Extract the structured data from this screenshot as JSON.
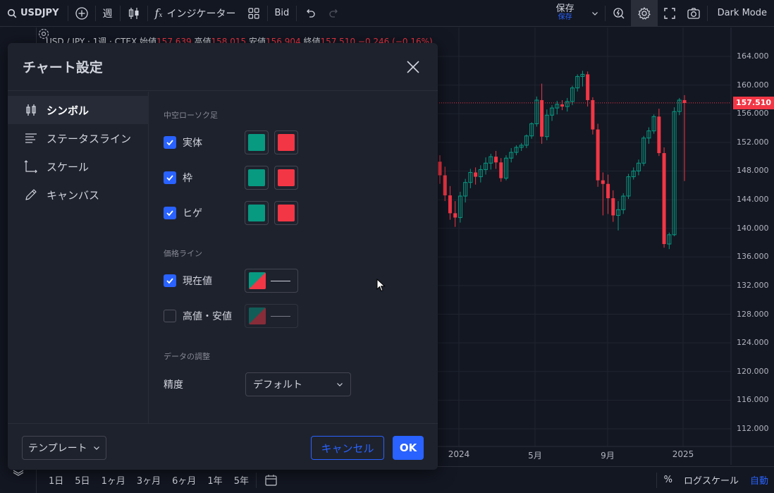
{
  "topbar": {
    "symbol": "USDJPY",
    "interval": "週",
    "indicators_label": "インジケーター",
    "price_source": "Bid",
    "save_label": "保存",
    "save_sub": "保存",
    "theme_label": "Dark Mode"
  },
  "legend": {
    "title": "USD / JPY · 1週 · CTEX",
    "open_label": "始値",
    "open": "157.639",
    "high_label": "高値",
    "high": "158.015",
    "low_label": "安値",
    "low": "156.904",
    "close_label": "終値",
    "close": "157.510",
    "change": "−0.246 (−0.16%)"
  },
  "price_badge": "157.510",
  "y_axis": [
    "164.000",
    "160.000",
    "156.000",
    "152.000",
    "148.000",
    "144.000",
    "140.000",
    "136.000",
    "132.000",
    "128.000",
    "124.000",
    "120.000",
    "116.000",
    "112.000"
  ],
  "x_axis": [
    "2024",
    "5月",
    "9月",
    "2025"
  ],
  "bottombar": {
    "ranges": [
      "1日",
      "5日",
      "1ヶ月",
      "3ヶ月",
      "6ヶ月",
      "1年",
      "5年"
    ],
    "percent": "%",
    "log_scale": "ログスケール",
    "auto": "自動"
  },
  "dialog": {
    "title": "チャート設定",
    "nav": [
      "シンボル",
      "ステータスライン",
      "スケール",
      "キャンバス"
    ],
    "sections": {
      "hollow_candles": "中空ローソク足",
      "price_lines": "価格ライン",
      "data_adjust": "データの調整"
    },
    "rows": {
      "body": "実体",
      "border": "枠",
      "wick": "ヒゲ",
      "last_price": "現在値",
      "high_low": "高値・安値",
      "precision": "精度"
    },
    "precision_value": "デフォルト",
    "template_label": "テンプレート",
    "cancel_label": "キャンセル",
    "ok_label": "OK"
  },
  "colors": {
    "up": "#089981",
    "down": "#f23645",
    "accent": "#2962ff"
  },
  "chart_data": {
    "type": "candlestick",
    "y_range": [
      110,
      166
    ],
    "x_range": [
      "2023-10",
      "2025-01"
    ],
    "last_price": 157.51,
    "candles": [
      [
        149.3,
        150.2,
        146.2,
        147.4
      ],
      [
        147.4,
        148.6,
        143.8,
        144.6
      ],
      [
        144.6,
        145.9,
        141.2,
        142.1
      ],
      [
        142.1,
        143.8,
        140.2,
        141.5
      ],
      [
        141.5,
        145.1,
        140.8,
        144.5
      ],
      [
        144.5,
        146.9,
        143.6,
        146.4
      ],
      [
        146.4,
        148.3,
        145.6,
        147.8
      ],
      [
        147.8,
        148.5,
        146.1,
        147.2
      ],
      [
        147.2,
        148.8,
        146.4,
        148.2
      ],
      [
        148.2,
        149.9,
        147.5,
        149.1
      ],
      [
        149.1,
        150.4,
        148.2,
        150.0
      ],
      [
        150.0,
        150.8,
        148.3,
        149.2
      ],
      [
        149.2,
        149.8,
        146.5,
        147.0
      ],
      [
        147.0,
        150.2,
        146.7,
        149.8
      ],
      [
        149.8,
        151.2,
        149.2,
        150.6
      ],
      [
        150.6,
        151.6,
        150.2,
        151.3
      ],
      [
        151.3,
        151.9,
        150.8,
        151.6
      ],
      [
        151.6,
        153.1,
        151.2,
        152.9
      ],
      [
        152.9,
        154.8,
        152.5,
        154.6
      ],
      [
        154.6,
        158.4,
        154.2,
        157.9
      ],
      [
        157.9,
        160.2,
        151.8,
        152.8
      ],
      [
        152.8,
        156.6,
        152.3,
        155.8
      ],
      [
        155.8,
        157.2,
        155.0,
        156.8
      ],
      [
        156.8,
        157.8,
        155.9,
        157.3
      ],
      [
        157.3,
        157.9,
        156.5,
        157.0
      ],
      [
        157.0,
        158.2,
        156.3,
        157.7
      ],
      [
        157.7,
        159.9,
        157.2,
        159.6
      ],
      [
        159.6,
        161.5,
        159.1,
        161.2
      ],
      [
        161.2,
        162.0,
        159.8,
        161.5
      ],
      [
        161.5,
        161.9,
        157.0,
        157.9
      ],
      [
        157.9,
        158.3,
        153.1,
        153.8
      ],
      [
        153.8,
        154.6,
        145.8,
        146.7
      ],
      [
        146.7,
        147.8,
        141.8,
        146.2
      ],
      [
        146.2,
        147.5,
        142.0,
        144.2
      ],
      [
        144.2,
        145.3,
        140.9,
        141.8
      ],
      [
        141.8,
        143.8,
        139.7,
        142.6
      ],
      [
        142.6,
        144.9,
        142.0,
        144.5
      ],
      [
        144.5,
        147.6,
        144.1,
        147.2
      ],
      [
        147.2,
        148.5,
        146.8,
        148.0
      ],
      [
        148.0,
        149.6,
        147.4,
        149.1
      ],
      [
        149.1,
        152.9,
        148.7,
        152.6
      ],
      [
        152.6,
        154.1,
        151.8,
        153.6
      ],
      [
        153.6,
        155.9,
        153.2,
        155.6
      ],
      [
        155.6,
        156.7,
        150.1,
        150.5
      ],
      [
        150.5,
        151.3,
        137.3,
        137.8
      ],
      [
        137.8,
        139.4,
        137.1,
        139.1
      ],
      [
        139.1,
        156.9,
        138.9,
        156.3
      ],
      [
        156.3,
        158.2,
        155.8,
        157.9
      ],
      [
        157.9,
        158.6,
        146.6,
        157.5
      ]
    ]
  }
}
